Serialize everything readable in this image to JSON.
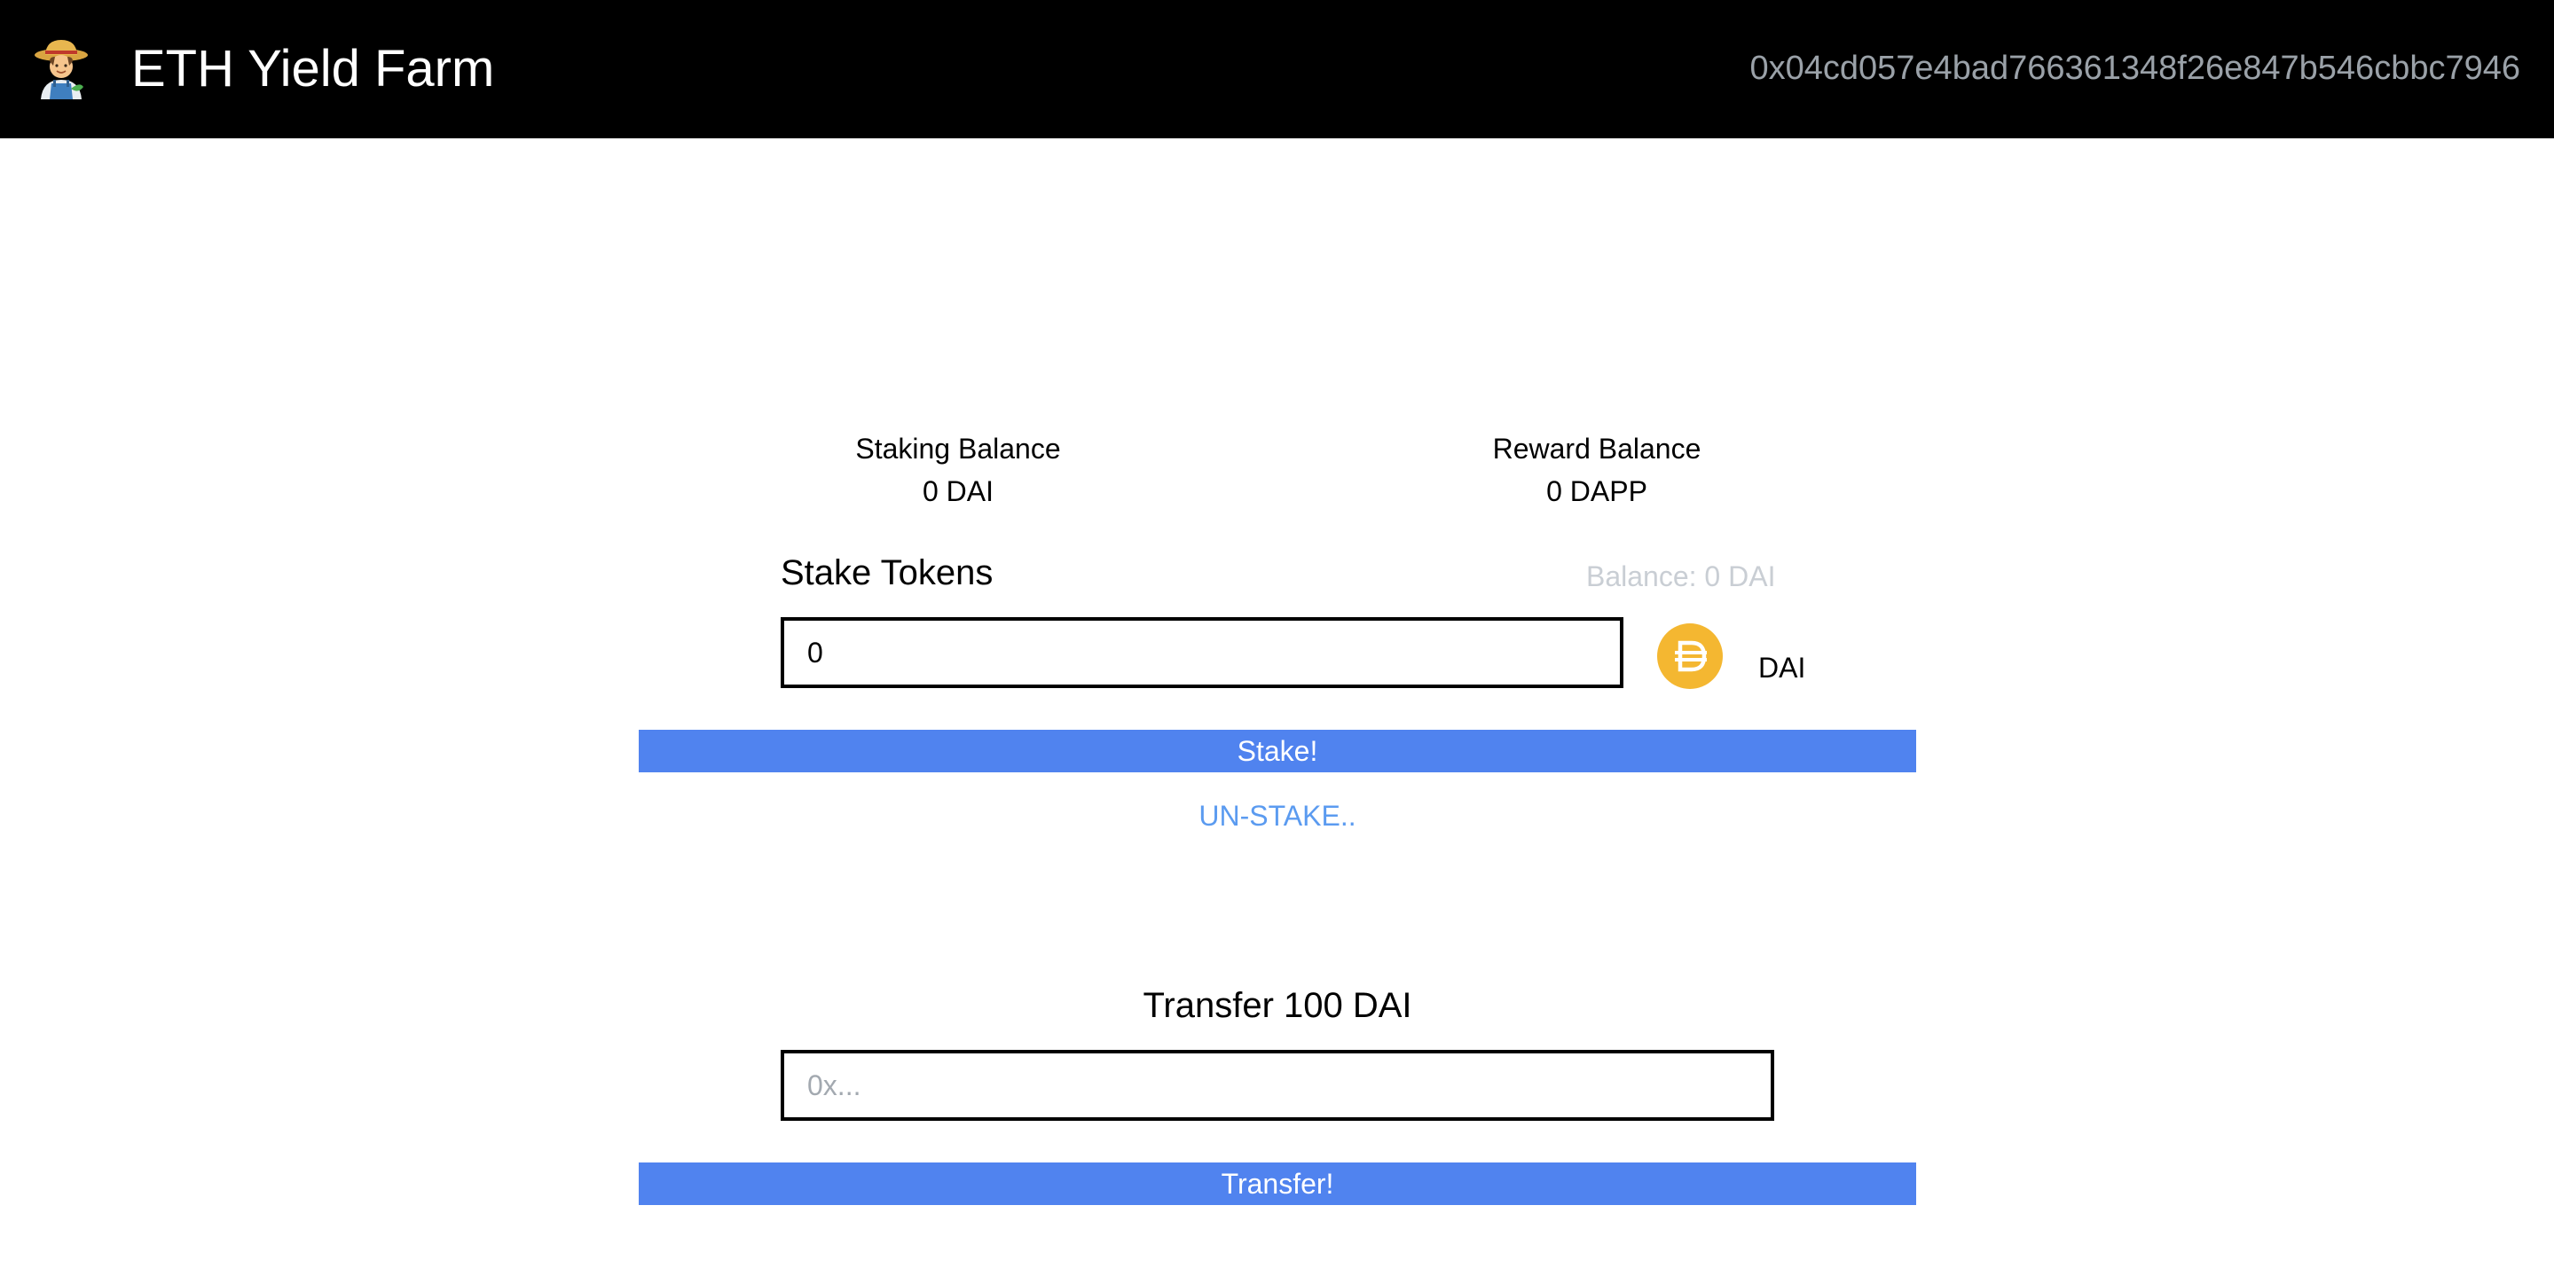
{
  "navbar": {
    "brand_icon": "farmer-emoji-icon",
    "title": "ETH Yield Farm",
    "account_address": "0x04cd057e4bad766361348f26e847b546cbbc7946"
  },
  "balances": {
    "staking": {
      "label": "Staking Balance",
      "value": "0 DAI"
    },
    "reward": {
      "label": "Reward Balance",
      "value": "0 DAPP"
    }
  },
  "stake_form": {
    "title": "Stake Tokens",
    "wallet_balance": "Balance: 0 DAI",
    "amount_value": "0",
    "token_icon": "dai-token-icon",
    "token_symbol": "DAI",
    "stake_label": "Stake!",
    "unstake_label": "UN-STAKE.."
  },
  "transfer_form": {
    "title": "Transfer 100 DAI",
    "address_placeholder": "0x...",
    "transfer_label": "Transfer!"
  },
  "colors": {
    "navbar_bg": "#000000",
    "button_blue": "#5083ef",
    "link_blue": "#5b9bf0",
    "dai_gold": "#f4b731",
    "muted_text": "#c9ced4"
  }
}
